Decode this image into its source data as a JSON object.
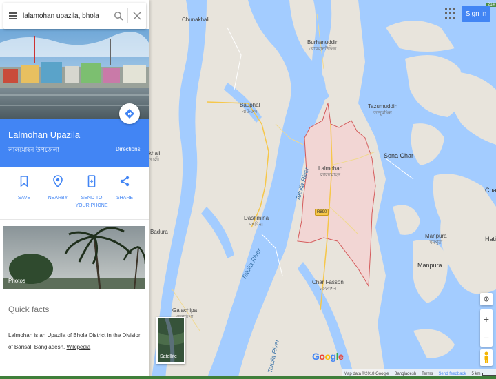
{
  "search": {
    "value": "lalamohan upazila, bhola"
  },
  "place": {
    "title": "Lalmohan Upazila",
    "subtitle": "লালমোহন উপজেলা",
    "directions_label": "Directions"
  },
  "actions": [
    {
      "label": "SAVE"
    },
    {
      "label": "NEARBY"
    },
    {
      "label": "SEND TO YOUR PHONE"
    },
    {
      "label": "SHARE"
    }
  ],
  "photos_label": "Photos",
  "quick_facts": {
    "title": "Quick facts",
    "text": "Lalmohan is an Upazila of Bhola District in the Division of Barisal, Bangladesh. ",
    "link": "Wikipedia"
  },
  "header": {
    "sign_in": "Sign in",
    "badge": "214"
  },
  "map": {
    "places": {
      "chunakhali": "Chunakhali",
      "burhanuddin": "Burhanuddin",
      "burhanuddin_bn": "বোরহানউদ্দিন",
      "bauphal": "Bauphal",
      "bauphal_bn": "বাউফল",
      "tazumuddin": "Tazumuddin",
      "tazumuddin_bn": "তজুমদ্দিন",
      "sona_char": "Sona Char",
      "lalmohan": "Lalmohan",
      "lalmohan_bn": "লালমোহন",
      "dashmina": "Dashmina",
      "dashmina_bn": "দশমিনা",
      "badura": "Badura",
      "char_fasson": "Char Fasson",
      "char_fasson_bn": "চরফ্যাশন",
      "manpura": "Manpura",
      "manpura_bn": "মনপুরা",
      "manpura2": "Manpura",
      "galachipa": "Galachipa",
      "galachipa_bn": "গলাচিপা",
      "khali": "khali",
      "khali_bn": "খালী",
      "char": "Char",
      "hatiy": "Hatiy"
    },
    "rivers": {
      "tetulia1": "Tetulia River",
      "tetulia2": "Tetulia River",
      "tetulia3": "Tetulia River"
    },
    "road_badge": "R890",
    "satellite_label": "Satellite",
    "google_logo": "Google",
    "footer": {
      "map_data": "Map data ©2018 Google",
      "country": "Bangladesh",
      "terms": "Terms",
      "feedback": "Send feedback",
      "scale": "5 km"
    }
  },
  "colors": {
    "water": "#a3ccff",
    "land": "#e8e4dc",
    "accent": "#4285f4",
    "highlight_fill": "#f2d6d4",
    "highlight_border": "#d45a5a",
    "road": "#f6c74a"
  },
  "icons": [
    "menu-icon",
    "search-icon",
    "close-icon",
    "directions-icon",
    "bookmark-icon",
    "nearby-icon",
    "send-to-phone-icon",
    "share-icon",
    "apps-icon",
    "my-location-icon",
    "zoom-in-icon",
    "zoom-out-icon",
    "pegman-icon"
  ]
}
